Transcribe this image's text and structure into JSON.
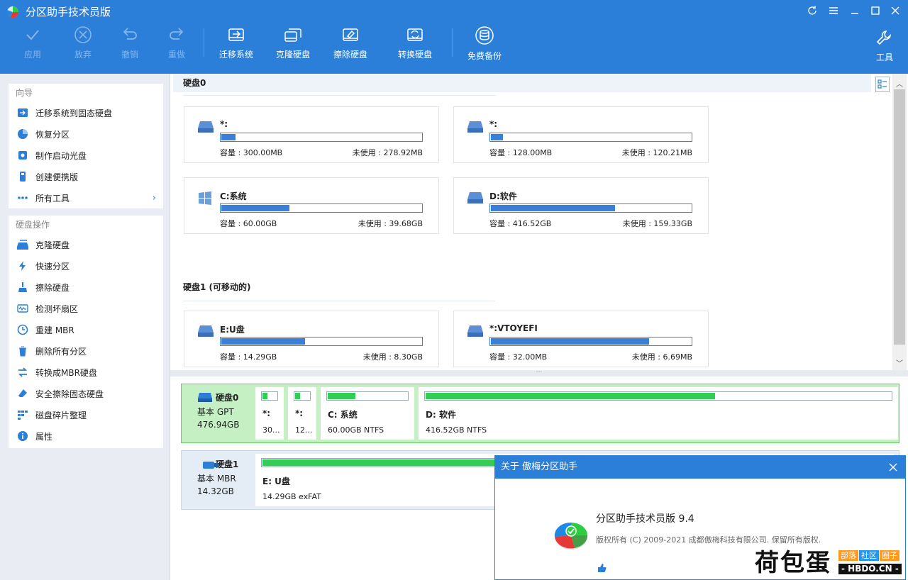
{
  "app": {
    "title": "分区助手技术员版"
  },
  "toolbar": {
    "apply": "应用",
    "discard": "放弃",
    "undo": "撤销",
    "redo": "重做",
    "migrate": "迁移系统",
    "clone": "克隆硬盘",
    "wipe": "擦除硬盘",
    "convert": "转换硬盘",
    "backup": "免费备份",
    "tools": "工具"
  },
  "sidebar": {
    "wizard_title": "向导",
    "wizard_items": [
      {
        "label": "迁移系统到固态硬盘",
        "icon": "migrate-ssd-icon"
      },
      {
        "label": "恢复分区",
        "icon": "recover-partition-icon"
      },
      {
        "label": "制作启动光盘",
        "icon": "bootable-disc-icon"
      },
      {
        "label": "创建便携版",
        "icon": "portable-icon"
      },
      {
        "label": "所有工具",
        "icon": "all-tools-icon"
      }
    ],
    "ops_title": "硬盘操作",
    "ops_items": [
      {
        "label": "克隆硬盘",
        "icon": "clone-disk-icon"
      },
      {
        "label": "快速分区",
        "icon": "quick-partition-icon"
      },
      {
        "label": "擦除硬盘",
        "icon": "wipe-disk-icon"
      },
      {
        "label": "检测坏扇区",
        "icon": "bad-sector-icon"
      },
      {
        "label": "重建 MBR",
        "icon": "rebuild-mbr-icon"
      },
      {
        "label": "删除所有分区",
        "icon": "delete-all-icon"
      },
      {
        "label": "转换成MBR硬盘",
        "icon": "convert-mbr-icon"
      },
      {
        "label": "安全擦除固态硬盘",
        "icon": "secure-erase-icon"
      },
      {
        "label": "磁盘碎片整理",
        "icon": "defrag-icon"
      },
      {
        "label": "属性",
        "icon": "info-icon"
      }
    ]
  },
  "disks_view": {
    "disk0_title": "硬盘0",
    "disk1_title": "硬盘1 (可移动的)",
    "cards": [
      {
        "name": "*:",
        "cap": "容量 : 300.00MB",
        "free": "未使用 : 278.92MB",
        "used": 0.07,
        "icon": "drive-icon"
      },
      {
        "name": "*:",
        "cap": "容量 : 128.00MB",
        "free": "未使用 : 120.21MB",
        "used": 0.06,
        "icon": "drive-icon"
      },
      {
        "name": "C:系统",
        "cap": "容量 : 60.00GB",
        "free": "未使用 : 39.68GB",
        "used": 0.34,
        "icon": "windows-icon"
      },
      {
        "name": "D:软件",
        "cap": "容量 : 416.52GB",
        "free": "未使用 : 159.33GB",
        "used": 0.62,
        "icon": "drive-icon"
      },
      {
        "name": "E:U盘",
        "cap": "容量 : 14.29GB",
        "free": "未使用 : 8.30GB",
        "used": 0.42,
        "icon": "drive-icon"
      },
      {
        "name": "*:VTOYEFI",
        "cap": "容量 : 32.00MB",
        "free": "未使用 : 6.69MB",
        "used": 0.79,
        "icon": "drive-icon"
      }
    ]
  },
  "disk_map": {
    "disk0": {
      "name": "硬盘0",
      "type": "基本 GPT",
      "size": "476.94GB",
      "parts": [
        {
          "label": "*:",
          "info": "30...",
          "used": 0.3
        },
        {
          "label": "*:",
          "info": "12...",
          "used": 0.3
        },
        {
          "label": "C: 系统",
          "info": "60.00GB NTFS",
          "used": 0.34
        },
        {
          "label": "D: 软件",
          "info": "416.52GB NTFS",
          "used": 0.62
        }
      ]
    },
    "disk1": {
      "name": "硬盘1",
      "type": "基本 MBR",
      "size": "14.32GB",
      "parts": [
        {
          "label": "E: U盘",
          "info": "14.29GB exFAT",
          "used": 0.42
        }
      ]
    }
  },
  "about": {
    "title": "关于 傲梅分区助手",
    "product": "分区助手技术员版 9.4",
    "copyright": "版权所有 (C) 2009-2021 成都傲梅科技有限公司. 保留所有版权."
  },
  "watermark": {
    "main": "荷包蛋",
    "tags": [
      "部落",
      "社区",
      "圈子"
    ],
    "url": "- HBDO.CN -"
  }
}
